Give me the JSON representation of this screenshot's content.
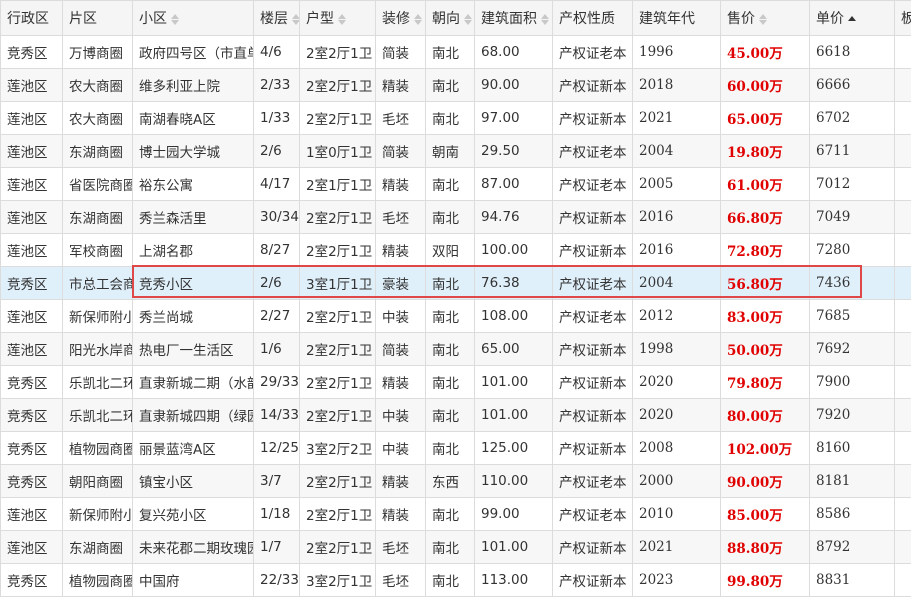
{
  "table": {
    "columns": [
      {
        "label": "行政区",
        "sortable": false
      },
      {
        "label": "片区",
        "sortable": false
      },
      {
        "label": "小区",
        "sortable": true
      },
      {
        "label": "楼层",
        "sortable": true
      },
      {
        "label": "户型",
        "sortable": true
      },
      {
        "label": "装修",
        "sortable": true
      },
      {
        "label": "朝向",
        "sortable": true
      },
      {
        "label": "建筑面积",
        "sortable": true
      },
      {
        "label": "产权性质",
        "sortable": false
      },
      {
        "label": "建筑年代",
        "sortable": false
      },
      {
        "label": "售价",
        "sortable": true
      },
      {
        "label": "单价",
        "sortable": true,
        "sort_active": "asc"
      },
      {
        "label": "板",
        "sortable": false
      }
    ],
    "rows": [
      [
        "竞秀区",
        "万博商圈",
        "政府四号区（市直单位）",
        "4/6",
        "2室2厅1卫",
        "简装",
        "南北",
        "68.00",
        "产权证老本",
        "1996",
        "45.00万",
        "6618"
      ],
      [
        "莲池区",
        "农大商圈",
        "维多利亚上院",
        "2/33",
        "2室2厅1卫",
        "精装",
        "南北",
        "90.00",
        "产权证新本",
        "2018",
        "60.00万",
        "6666"
      ],
      [
        "莲池区",
        "农大商圈",
        "南湖春晓A区",
        "1/33",
        "2室2厅1卫",
        "毛坯",
        "南北",
        "97.00",
        "产权证新本",
        "2021",
        "65.00万",
        "6702"
      ],
      [
        "莲池区",
        "东湖商圈",
        "博士园大学城",
        "2/6",
        "1室0厅1卫",
        "简装",
        "朝南",
        "29.50",
        "产权证老本",
        "2004",
        "19.80万",
        "6711"
      ],
      [
        "莲池区",
        "省医院商圈",
        "裕东公寓",
        "4/17",
        "2室1厅1卫",
        "精装",
        "南北",
        "87.00",
        "产权证老本",
        "2005",
        "61.00万",
        "7012"
      ],
      [
        "莲池区",
        "东湖商圈",
        "秀兰森活里",
        "30/34",
        "2室2厅1卫",
        "毛坯",
        "南北",
        "94.76",
        "产权证新本",
        "2016",
        "66.80万",
        "7049"
      ],
      [
        "莲池区",
        "军校商圈",
        "上湖名郡",
        "8/27",
        "2室2厅1卫",
        "精装",
        "双阳",
        "100.00",
        "产权证新本",
        "2016",
        "72.80万",
        "7280"
      ],
      [
        "竞秀区",
        "市总工会商圈",
        "竞秀小区",
        "2/6",
        "3室1厅1卫",
        "豪装",
        "南北",
        "76.38",
        "产权证老本",
        "2004",
        "56.80万",
        "7436"
      ],
      [
        "莲池区",
        "新保师附小",
        "秀兰尚城",
        "2/27",
        "2室2厅1卫",
        "中装",
        "南北",
        "108.00",
        "产权证老本",
        "2012",
        "83.00万",
        "7685"
      ],
      [
        "莲池区",
        "阳光水岸商圈",
        "热电厂一生活区",
        "1/6",
        "2室2厅1卫",
        "简装",
        "南北",
        "65.00",
        "产权证新本",
        "1998",
        "50.00万",
        "7692"
      ],
      [
        "竞秀区",
        "乐凯北二环",
        "直隶新城二期（水韵）",
        "29/33",
        "2室2厅1卫",
        "精装",
        "南北",
        "101.00",
        "产权证新本",
        "2020",
        "79.80万",
        "7900"
      ],
      [
        "竞秀区",
        "乐凯北二环",
        "直隶新城四期（绿园）",
        "14/33",
        "2室2厅1卫",
        "中装",
        "南北",
        "101.00",
        "产权证新本",
        "2020",
        "80.00万",
        "7920"
      ],
      [
        "竞秀区",
        "植物园商圈",
        "丽景蓝湾A区",
        "12/25",
        "3室2厅2卫",
        "中装",
        "南北",
        "125.00",
        "产权证新本",
        "2008",
        "102.00万",
        "8160"
      ],
      [
        "竞秀区",
        "朝阳商圈",
        "镇宝小区",
        "3/7",
        "2室2厅1卫",
        "精装",
        "东西",
        "110.00",
        "产权证老本",
        "2000",
        "90.00万",
        "8181"
      ],
      [
        "莲池区",
        "新保师附小",
        "复兴苑小区",
        "1/18",
        "2室2厅1卫",
        "精装",
        "南北",
        "99.00",
        "产权证老本",
        "2010",
        "85.00万",
        "8586"
      ],
      [
        "莲池区",
        "东湖商圈",
        "未来花郡二期玫瑰园",
        "1/7",
        "2室2厅1卫",
        "毛坯",
        "南北",
        "101.00",
        "产权证新本",
        "2021",
        "88.80万",
        "8792"
      ],
      [
        "竞秀区",
        "植物园商圈",
        "中国府",
        "22/33",
        "3室2厅1卫",
        "毛坯",
        "南北",
        "113.00",
        "产权证新本",
        "2023",
        "99.80万",
        "8831"
      ]
    ],
    "selected_row": 7
  },
  "colors": {
    "price": "#e00000",
    "selected_row_bg": "#e0f0fb",
    "highlight_border": "#e04848"
  }
}
